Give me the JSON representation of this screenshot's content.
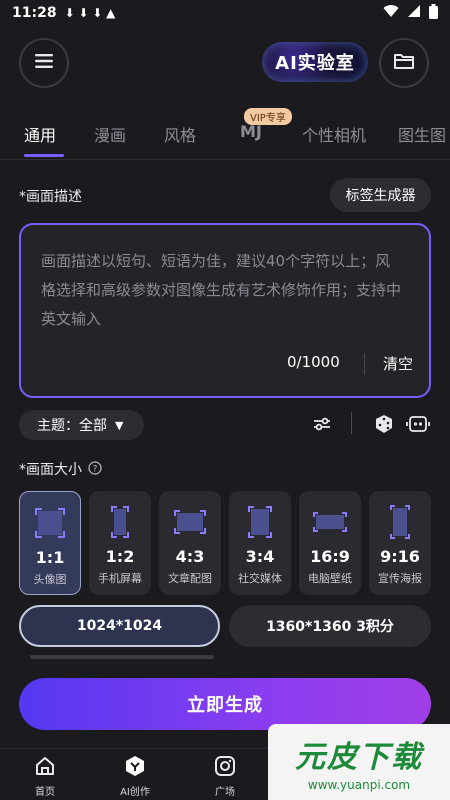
{
  "status_bar": {
    "time": "11:28",
    "notifications": "⬇ ⬇ ⬇ ▲"
  },
  "header": {
    "logo_text": "AI实验室"
  },
  "tabs": [
    {
      "label": "通用",
      "active": true
    },
    {
      "label": "漫画"
    },
    {
      "label": "风格"
    },
    {
      "label": "MJ",
      "badge": "VIP专享"
    },
    {
      "label": "个性相机"
    },
    {
      "label": "图生图"
    }
  ],
  "description": {
    "label": "*画面描述",
    "tag_generator": "标签生成器",
    "placeholder": "画面描述以短句、短语为佳，建议40个字符以上；风格选择和高级参数对图像生成有艺术修饰作用；支持中英文输入",
    "count": "0/1000",
    "clear": "清空"
  },
  "theme": {
    "label": "主题：全部"
  },
  "size": {
    "label": "*画面大小",
    "ratios": [
      {
        "ratio": "1:1",
        "label": "头像图",
        "active": true
      },
      {
        "ratio": "1:2",
        "label": "手机屏幕"
      },
      {
        "ratio": "4:3",
        "label": "文章配图"
      },
      {
        "ratio": "3:4",
        "label": "社交媒体"
      },
      {
        "ratio": "16:9",
        "label": "电脑壁纸"
      },
      {
        "ratio": "9:16",
        "label": "宣传海报"
      }
    ],
    "resolutions": [
      {
        "label": "1024*1024",
        "active": true
      },
      {
        "label": "1360*1360 3积分"
      }
    ]
  },
  "generate_button": "立即生成",
  "bottom_nav": [
    {
      "label": "首页",
      "icon": "home-icon"
    },
    {
      "label": "AI创作",
      "icon": "ai-create-icon"
    },
    {
      "label": "广场",
      "icon": "square-icon"
    }
  ],
  "watermark": {
    "title": "元皮下载",
    "url": "www.yuanpi.com"
  },
  "colors": {
    "accent": "#7b5cff",
    "background": "#1b1b1f",
    "card": "#2a2a30"
  }
}
